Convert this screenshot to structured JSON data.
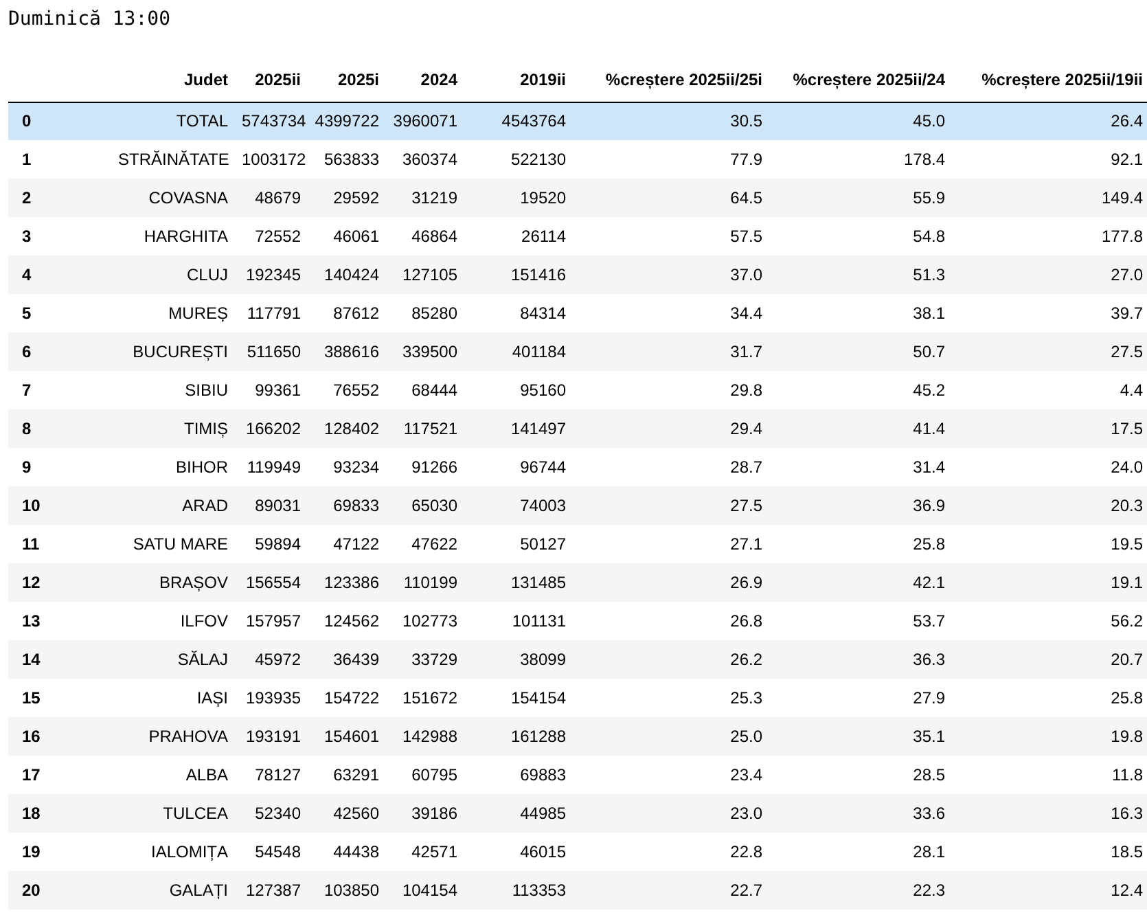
{
  "title": "Duminică 13:00",
  "table": {
    "columns": [
      "Judet",
      "2025ii",
      "2025i",
      "2024",
      "2019ii",
      "%creștere 2025ii/25i",
      "%creștere 2025ii/24",
      "%creștere 2025ii/19ii"
    ],
    "rows": [
      {
        "index": "0",
        "selected": true,
        "cells": [
          "TOTAL",
          "5743734",
          "4399722",
          "3960071",
          "4543764",
          "30.5",
          "45.0",
          "26.4"
        ]
      },
      {
        "index": "1",
        "selected": false,
        "cells": [
          "STRĂINĂTATE",
          "1003172",
          "563833",
          "360374",
          "522130",
          "77.9",
          "178.4",
          "92.1"
        ]
      },
      {
        "index": "2",
        "selected": false,
        "cells": [
          "COVASNA",
          "48679",
          "29592",
          "31219",
          "19520",
          "64.5",
          "55.9",
          "149.4"
        ]
      },
      {
        "index": "3",
        "selected": false,
        "cells": [
          "HARGHITA",
          "72552",
          "46061",
          "46864",
          "26114",
          "57.5",
          "54.8",
          "177.8"
        ]
      },
      {
        "index": "4",
        "selected": false,
        "cells": [
          "CLUJ",
          "192345",
          "140424",
          "127105",
          "151416",
          "37.0",
          "51.3",
          "27.0"
        ]
      },
      {
        "index": "5",
        "selected": false,
        "cells": [
          "MUREȘ",
          "117791",
          "87612",
          "85280",
          "84314",
          "34.4",
          "38.1",
          "39.7"
        ]
      },
      {
        "index": "6",
        "selected": false,
        "cells": [
          "BUCUREȘTI",
          "511650",
          "388616",
          "339500",
          "401184",
          "31.7",
          "50.7",
          "27.5"
        ]
      },
      {
        "index": "7",
        "selected": false,
        "cells": [
          "SIBIU",
          "99361",
          "76552",
          "68444",
          "95160",
          "29.8",
          "45.2",
          "4.4"
        ]
      },
      {
        "index": "8",
        "selected": false,
        "cells": [
          "TIMIȘ",
          "166202",
          "128402",
          "117521",
          "141497",
          "29.4",
          "41.4",
          "17.5"
        ]
      },
      {
        "index": "9",
        "selected": false,
        "cells": [
          "BIHOR",
          "119949",
          "93234",
          "91266",
          "96744",
          "28.7",
          "31.4",
          "24.0"
        ]
      },
      {
        "index": "10",
        "selected": false,
        "cells": [
          "ARAD",
          "89031",
          "69833",
          "65030",
          "74003",
          "27.5",
          "36.9",
          "20.3"
        ]
      },
      {
        "index": "11",
        "selected": false,
        "cells": [
          "SATU MARE",
          "59894",
          "47122",
          "47622",
          "50127",
          "27.1",
          "25.8",
          "19.5"
        ]
      },
      {
        "index": "12",
        "selected": false,
        "cells": [
          "BRAȘOV",
          "156554",
          "123386",
          "110199",
          "131485",
          "26.9",
          "42.1",
          "19.1"
        ]
      },
      {
        "index": "13",
        "selected": false,
        "cells": [
          "ILFOV",
          "157957",
          "124562",
          "102773",
          "101131",
          "26.8",
          "53.7",
          "56.2"
        ]
      },
      {
        "index": "14",
        "selected": false,
        "cells": [
          "SĂLAJ",
          "45972",
          "36439",
          "33729",
          "38099",
          "26.2",
          "36.3",
          "20.7"
        ]
      },
      {
        "index": "15",
        "selected": false,
        "cells": [
          "IAȘI",
          "193935",
          "154722",
          "151672",
          "154154",
          "25.3",
          "27.9",
          "25.8"
        ]
      },
      {
        "index": "16",
        "selected": false,
        "cells": [
          "PRAHOVA",
          "193191",
          "154601",
          "142988",
          "161288",
          "25.0",
          "35.1",
          "19.8"
        ]
      },
      {
        "index": "17",
        "selected": false,
        "cells": [
          "ALBA",
          "78127",
          "63291",
          "60795",
          "69883",
          "23.4",
          "28.5",
          "11.8"
        ]
      },
      {
        "index": "18",
        "selected": false,
        "cells": [
          "TULCEA",
          "52340",
          "42560",
          "39186",
          "44985",
          "23.0",
          "33.6",
          "16.3"
        ]
      },
      {
        "index": "19",
        "selected": false,
        "cells": [
          "IALOMIȚA",
          "54548",
          "44438",
          "42571",
          "46015",
          "22.8",
          "28.1",
          "18.5"
        ]
      },
      {
        "index": "20",
        "selected": false,
        "cells": [
          "GALAȚI",
          "127387",
          "103850",
          "104154",
          "113353",
          "22.7",
          "22.3",
          "12.4"
        ]
      }
    ]
  }
}
